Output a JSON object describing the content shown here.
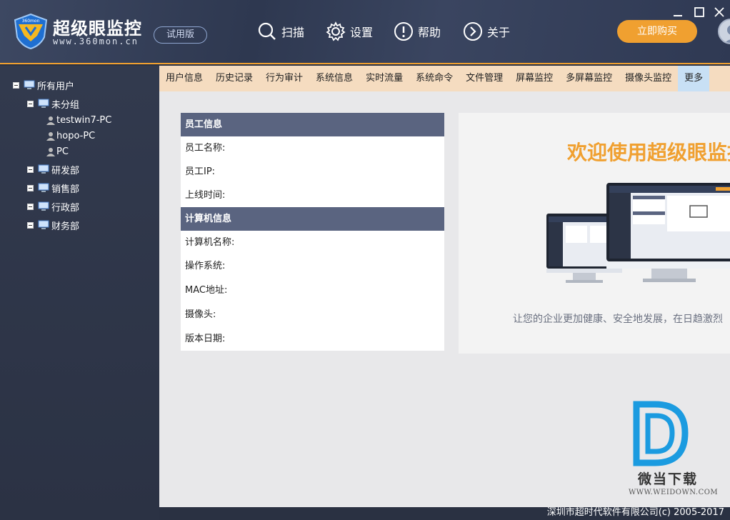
{
  "app": {
    "title": "超级眼监控",
    "url": "www.360mon.cn",
    "shield_text": "360mon",
    "trial_label": "试用版"
  },
  "nav": {
    "scan": "扫描",
    "settings": "设置",
    "help": "帮助",
    "about": "关于",
    "buy": "立即购买"
  },
  "tree": {
    "root": "所有用户",
    "ungrouped": "未分组",
    "pc1": "testwin7-PC",
    "pc2": "hopo-PC",
    "pc3": "PC",
    "dept1": "研发部",
    "dept2": "销售部",
    "dept3": "行政部",
    "dept4": "财务部"
  },
  "tabs": {
    "t1": "用户信息",
    "t2": "历史记录",
    "t3": "行为审计",
    "t4": "系统信息",
    "t5": "实时流量",
    "t6": "系统命令",
    "t7": "文件管理",
    "t8": "屏幕监控",
    "t9": "多屏幕监控",
    "t10": "摄像头监控",
    "t11": "更多"
  },
  "employee": {
    "header": "员工信息",
    "name": "员工名称:",
    "ip": "员工IP:",
    "online": "上线时间:"
  },
  "computer": {
    "header": "计算机信息",
    "name": "计算机名称:",
    "os": "操作系统:",
    "mac": "MAC地址:",
    "camera": "摄像头:",
    "version_date": "版本日期:"
  },
  "welcome": {
    "title": "欢迎使用超级眼监控",
    "subtitle": "让您的企业更加健康、安全地发展，在日趋激烈"
  },
  "watermark": {
    "name": "微当下载",
    "url": "WWW.WEIDOWN.COM"
  },
  "footer": {
    "copyright": "深圳市超时代软件有限公司(c) 2005-2017"
  },
  "colors": {
    "accent": "#f0a030",
    "header_bg": "#2e3850",
    "section_header": "#5a6480",
    "tab_bar": "#f5dcc0",
    "tab_active": "#c8e0f5"
  }
}
